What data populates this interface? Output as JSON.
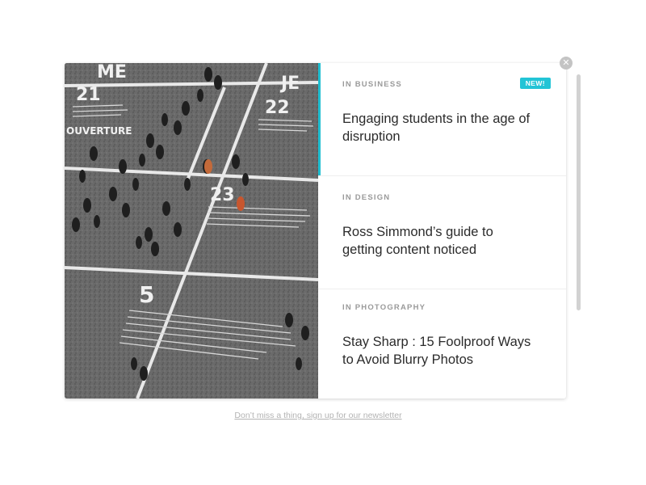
{
  "articles": [
    {
      "category": "IN BUSINESS",
      "title": "Engaging students in the age of disruption",
      "badge": "NEW!"
    },
    {
      "category": "IN DESIGN",
      "title": "Ross Simmond’s guide to getting content noticed"
    },
    {
      "category": "IN PHOTOGRAPHY",
      "title": "Stay Sharp : 15 Foolproof Ways to Avoid Blurry Photos"
    }
  ],
  "photo": {
    "numbers": [
      "21",
      "22",
      "23",
      "5"
    ],
    "words": [
      "ME",
      "JE",
      "OUVERTURE"
    ]
  },
  "accent_color": "#1fbfd1",
  "close_icon": "close-icon",
  "newsletter_link": "Don’t miss a thing, sign up for our newsletter"
}
